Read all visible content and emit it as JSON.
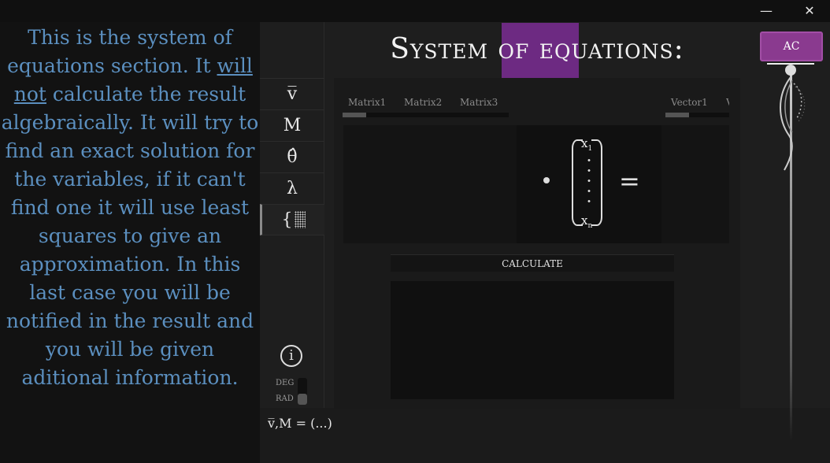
{
  "window": {
    "minimize_glyph": "—",
    "close_glyph": "✕"
  },
  "help": {
    "pre": "This is the system of equations section. It ",
    "underlined": "will not",
    "post": " calculate the result algebraically. It will try to find an exact solution for the variables, if it can't find one it will use least squares to give an approximation. In this last case you will be notified in the result and you will be given aditional information."
  },
  "sidebar": {
    "items": [
      {
        "label": "v̅",
        "icon": "vector-icon"
      },
      {
        "label": "M",
        "icon": "matrix-icon"
      },
      {
        "label": "θ̂",
        "icon": "angle-icon"
      },
      {
        "label": "λ",
        "icon": "lambda-icon"
      },
      {
        "label": "{",
        "icon": "system-icon"
      }
    ],
    "info_glyph": "i",
    "deg_label": "DEG",
    "rad_label": "RAD",
    "angle_unit_selected": "RAD"
  },
  "main": {
    "title": "System of equations:",
    "matrix_tabs": [
      "Matrix1",
      "Matrix2",
      "Matrix3"
    ],
    "vector_tabs": [
      "Vector1",
      "V"
    ],
    "var_first": "x",
    "var_first_sub": "1",
    "var_last": "x",
    "var_last_sub": "n",
    "dot": "•",
    "equals": "=",
    "calculate_label": "CALCULATE",
    "status": "v̅,M = (...)"
  },
  "right": {
    "ac_label": "AC"
  },
  "colors": {
    "accent": "#8a3a8f",
    "help_text": "#5b8fbf",
    "background": "#1e1e1e"
  }
}
